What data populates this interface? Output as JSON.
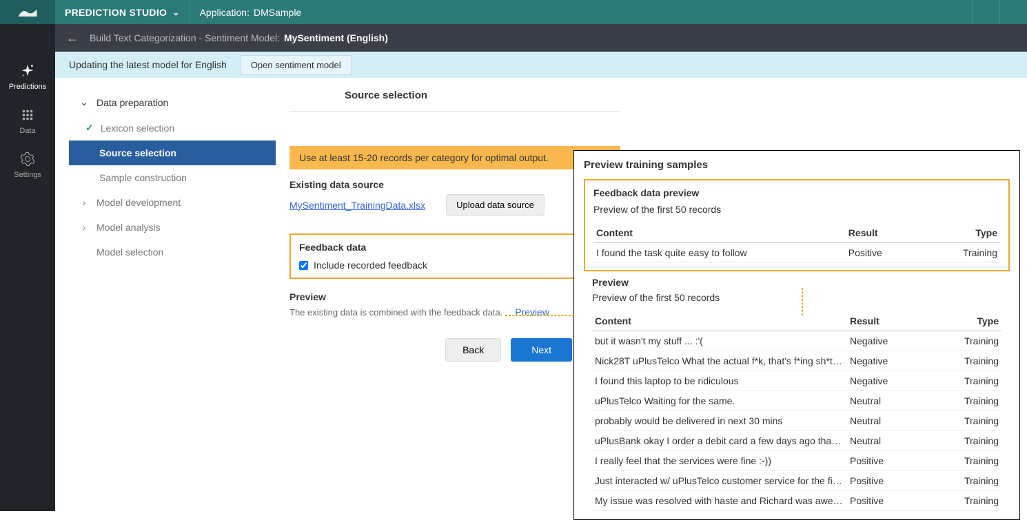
{
  "header": {
    "studio_title": "PREDICTION STUDIO",
    "app_label": "Application:",
    "app_name": "DMSample"
  },
  "subheader": {
    "breadcrumb": "Build Text Categorization - Sentiment Model:",
    "model_name": "MySentiment  (English)"
  },
  "sidebar": {
    "items": [
      {
        "label": "Predictions"
      },
      {
        "label": "Data"
      },
      {
        "label": "Settings"
      }
    ]
  },
  "banner": {
    "text_prefix": "Updating the latest model for ",
    "lang": "English",
    "open_btn": "Open sentiment model"
  },
  "steps": {
    "group1": "Data preparation",
    "sub1": "Lexicon selection",
    "sub2": "Source selection",
    "sub3": "Sample construction",
    "group2": "Model development",
    "group3": "Model analysis",
    "group4": "Model selection"
  },
  "main": {
    "title": "Source selection",
    "warning": "Use at least 15-20 records per category for optimal output.",
    "existing_label": "Existing data source",
    "data_file": "MySentiment_TrainingData.xlsx",
    "upload_btn": "Upload data source",
    "feedback_title": "Feedback data",
    "feedback_check": "Include recorded feedback",
    "preview_title": "Preview",
    "preview_desc": "The existing data is combined with the feedback data.",
    "preview_link": "Preview",
    "back_btn": "Back",
    "next_btn": "Next"
  },
  "preview_panel": {
    "title": "Preview training samples",
    "feedback_section": {
      "title": "Feedback data preview",
      "desc": "Preview of the first 50 records",
      "col_content": "Content",
      "col_result": "Result",
      "col_type": "Type",
      "rows": [
        {
          "content": "I found the task quite easy to follow",
          "result": "Positive",
          "type": "Training"
        }
      ]
    },
    "preview_section": {
      "title": "Preview",
      "desc": "Preview of the first 50 records",
      "col_content": "Content",
      "col_result": "Result",
      "col_type": "Type",
      "rows": [
        {
          "content": "but it wasn't my stuff ... :'(",
          "result": "Negative",
          "type": "Training"
        },
        {
          "content": "Nick28T uPlusTelco What the actual f*k, that's f*ing sh*t…",
          "result": "Negative",
          "type": "Training"
        },
        {
          "content": "I found this laptop to be ridiculous",
          "result": "Negative",
          "type": "Training"
        },
        {
          "content": "uPlusTelco Waiting for the same.",
          "result": "Neutral",
          "type": "Training"
        },
        {
          "content": "probably would be delivered in next 30 mins",
          "result": "Neutral",
          "type": "Training"
        },
        {
          "content": "uPlusBank okay I order a debit card a few days ago than…",
          "result": "Neutral",
          "type": "Training"
        },
        {
          "content": "I really feel that the services were fine :-))",
          "result": "Positive",
          "type": "Training"
        },
        {
          "content": "Just interacted w/ uPlusTelco customer service for the fi…",
          "result": "Positive",
          "type": "Training"
        },
        {
          "content": "My issue was resolved with haste and Richard was awes…",
          "result": "Positive",
          "type": "Training"
        }
      ]
    }
  }
}
